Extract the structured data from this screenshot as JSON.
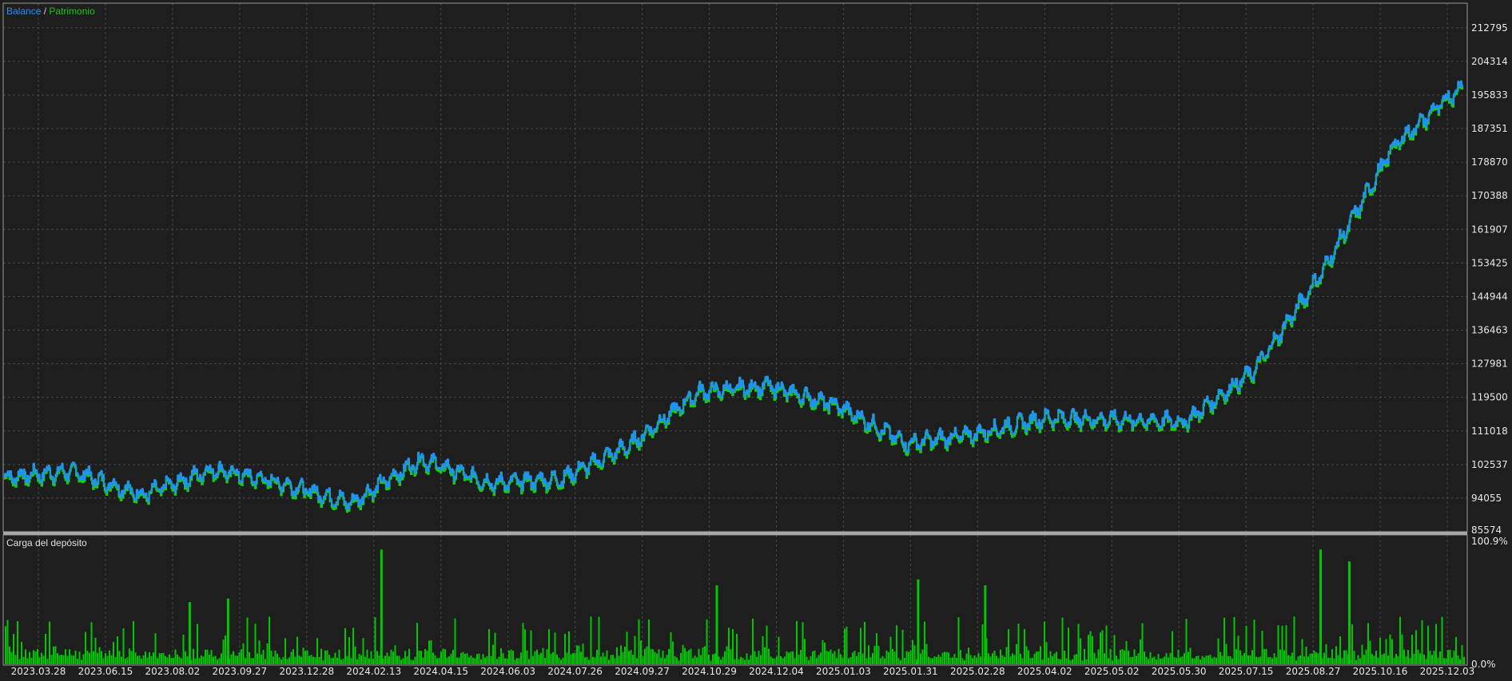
{
  "legend": {
    "balance": "Balance",
    "separator": " / ",
    "equity": "Patrimonio"
  },
  "subchart": {
    "title": "Carga del depósito",
    "ymax_label": "100.9%",
    "ymin_label": "0.0%"
  },
  "colors": {
    "background": "#1e1e1e",
    "grid": "#474747",
    "frame": "#9a9a9a",
    "balance": "#1e90ff",
    "equity": "#19c819",
    "load": "#00c800",
    "text": "#e8e8e8"
  },
  "chart_data": [
    {
      "type": "line",
      "x": [
        "2023.03.28",
        "2023.06.15",
        "2023.08.02",
        "2023.09.27",
        "2023.12.28",
        "2024.02.13",
        "2024.04.15",
        "2024.06.03",
        "2024.07.26",
        "2024.09.27",
        "2024.10.29",
        "2024.12.04",
        "2025.01.03",
        "2025.01.31",
        "2025.02.28",
        "2025.04.02",
        "2025.05.02",
        "2025.05.30",
        "2025.07.15",
        "2025.08.27",
        "2025.10.16",
        "2025.12.03"
      ],
      "series": [
        {
          "name": "Balance",
          "values": [
            99500,
            101000,
            95000,
            101500,
            98000,
            93000,
            104000,
            98000,
            99000,
            107500,
            121000,
            122500,
            117500,
            108000,
            110500,
            114500,
            114000,
            113500,
            126500,
            152000,
            183000,
            198500
          ]
        },
        {
          "name": "Patrimonio",
          "values": [
            99000,
            100500,
            94500,
            101000,
            97500,
            92500,
            103500,
            97500,
            98500,
            107000,
            120500,
            122000,
            117000,
            107500,
            110000,
            114000,
            113500,
            113000,
            126000,
            151500,
            182500,
            198000
          ]
        }
      ],
      "yticks": [
        85574,
        94055,
        102537,
        111018,
        119500,
        127981,
        136463,
        144944,
        153425,
        161907,
        170388,
        178870,
        187351,
        195833,
        204314,
        212795
      ],
      "ylim": [
        85574,
        219000
      ],
      "grid": true,
      "legend": "top-left"
    },
    {
      "type": "bar",
      "title": "Carga del depósito",
      "ylim": [
        0,
        100.9
      ],
      "yticks": [
        "0.0%",
        "100.9%"
      ],
      "grid": true,
      "spikes": [
        {
          "x": "2024.02.13",
          "value": 96
        },
        {
          "x": "2025.08.27",
          "value": 96
        },
        {
          "x": "2025.08.27",
          "value": 86
        },
        {
          "x": "2024.10.29",
          "value": 66
        },
        {
          "x": "2025.01.31",
          "value": 71
        },
        {
          "x": "2025.02.28",
          "value": 66
        },
        {
          "x": "2023.09.27",
          "value": 55
        },
        {
          "x": "2023.08.02",
          "value": 52
        }
      ],
      "typical_range": [
        5,
        40
      ]
    }
  ]
}
